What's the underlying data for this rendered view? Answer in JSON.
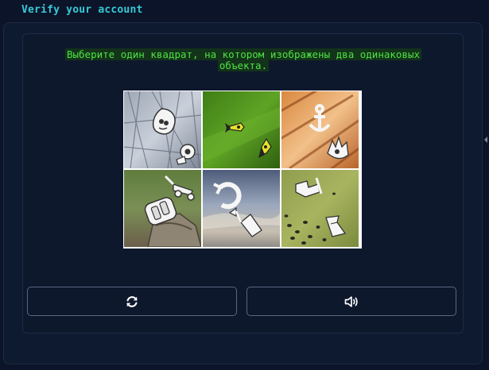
{
  "header": {
    "title": "Verify your account"
  },
  "captcha": {
    "instruction": "Выберите один квадрат, на котором изображены два одинаковых объекта.",
    "tiles": [
      {
        "name": "tile-1",
        "background": "frosted-grass",
        "icons": [
          "drop-face-icon",
          "gear-hand-icon"
        ]
      },
      {
        "name": "tile-2",
        "background": "green-grass",
        "icons": [
          "rocket-icon",
          "rocket-icon"
        ]
      },
      {
        "name": "tile-3",
        "background": "wood-planks",
        "icons": [
          "anchor-icon",
          "fire-hand-icon"
        ]
      },
      {
        "name": "tile-4",
        "background": "tree-stump",
        "icons": [
          "lawnmower-icon",
          "backpack-icon"
        ]
      },
      {
        "name": "tile-5",
        "background": "sky",
        "icons": [
          "refresh-arrow-icon",
          "share-arrow-icon"
        ]
      },
      {
        "name": "tile-6",
        "background": "field-with-animals",
        "icons": [
          "dress-icon",
          "vase-icon"
        ]
      }
    ],
    "buttons": [
      {
        "name": "reload-button",
        "icon": "refresh-icon"
      },
      {
        "name": "audio-button",
        "icon": "speaker-icon"
      }
    ]
  },
  "colors": {
    "background": "#0b1428",
    "title": "#38c9d6",
    "instruction_text": "#4ee244",
    "instruction_highlight": "#13331a",
    "button_border": "#5a6780"
  }
}
